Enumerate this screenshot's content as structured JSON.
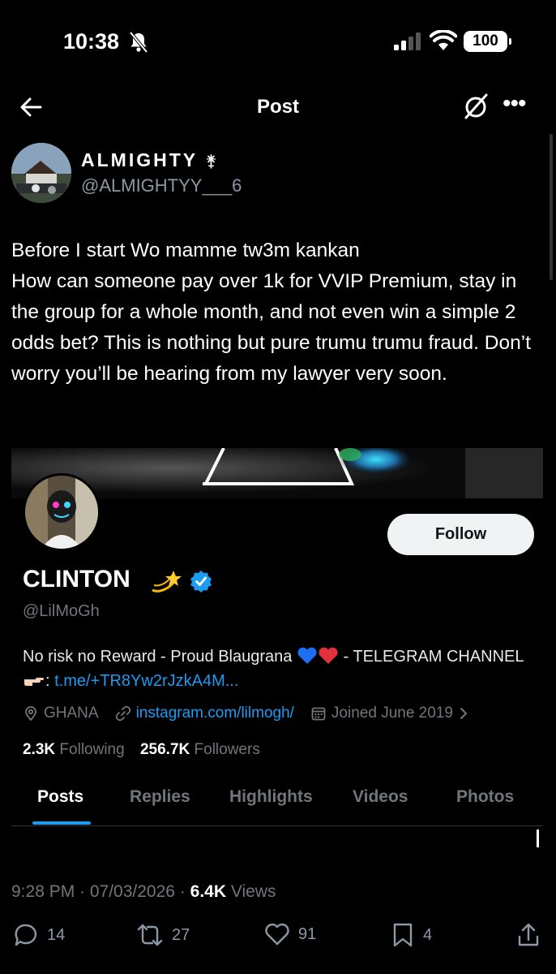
{
  "status_bar": {
    "time": "10:38",
    "battery": "100",
    "icons": [
      "bell-slash-icon",
      "signal-icon",
      "wifi-icon",
      "battery-icon"
    ]
  },
  "nav": {
    "title": "Post",
    "icons": [
      "back-arrow-icon",
      "grok-icon",
      "more-icon"
    ]
  },
  "post": {
    "author_name": "ALMIGHTY",
    "author_symbol": "⚵",
    "author_handle": "@ALMIGHTYY___6",
    "text": "Before I start Wo mamme tw3m kankan\nHow can someone pay over 1k for  VVIP Premium, stay in the group for a whole month, and not even win a simple 2 odds bet? This is nothing but pure trumu trumu fraud. Don’t worry you’ll be hearing from my lawyer very soon.",
    "timestamp": "9:28 PM · 07/03/2026 · ",
    "views_count": "6.4K",
    "views_label": " Views"
  },
  "profile_card": {
    "name": "CLINTON",
    "handle": "@LilMoGh",
    "follow_label": "Follow",
    "bio_text": "No risk no Reward - Proud Blaugrana ",
    "bio_suffix": " - TELEGRAM CHANNEL ",
    "bio_link": "t.me/+TR8Yw2rJzkA4M...",
    "location": "GHANA",
    "website": "instagram.com/lilmogh/",
    "joined": "Joined June 2019",
    "following_count": "2.3K",
    "following_label": " Following",
    "followers_count": "256.7K",
    "followers_label": " Followers",
    "tabs": [
      "Posts",
      "Replies",
      "Highlights",
      "Videos",
      "Photos"
    ],
    "active_tab": "Posts",
    "accent_color": "#1d9bf0"
  },
  "actions": {
    "replies": "14",
    "reposts": "27",
    "likes": "91",
    "bookmarks": "4"
  }
}
